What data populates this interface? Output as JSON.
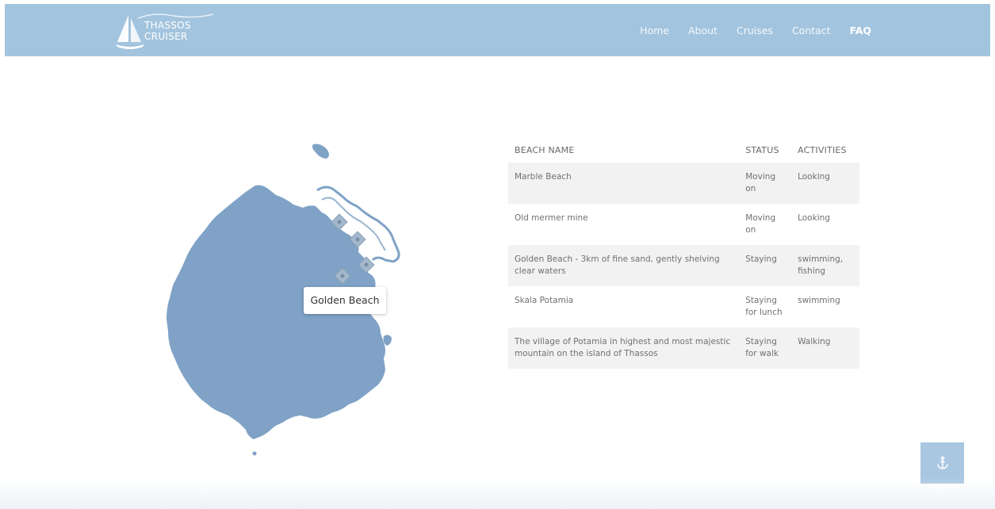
{
  "header": {
    "logo": {
      "line1": "THASSOS",
      "line2": "CRUISER"
    },
    "nav": [
      {
        "label": "Home",
        "active": false
      },
      {
        "label": "About",
        "active": false
      },
      {
        "label": "Cruises",
        "active": false
      },
      {
        "label": "Contact",
        "active": false
      },
      {
        "label": "FAQ",
        "active": true
      }
    ]
  },
  "map": {
    "tooltip": "Golden Beach",
    "marker_icon": "map-marker-icon",
    "island_color": "#7fa2c6"
  },
  "table": {
    "headers": {
      "name": "BEACH NAME",
      "status": "STATUS",
      "activities": "ACTIVITIES"
    },
    "rows": [
      {
        "name": "Marble Beach",
        "status": "Moving on",
        "activities": "Looking"
      },
      {
        "name": "Old mermer mine",
        "status": "Moving on",
        "activities": "Looking"
      },
      {
        "name": "Golden Beach - 3km of fine sand, gently shelving clear waters",
        "status": "Staying",
        "activities": "swimming, fishing"
      },
      {
        "name": "Skala Potamia",
        "status": "Staying for lunch",
        "activities": "swimming"
      },
      {
        "name": "The village of Potamia in highest and most majestic mountain on the island of Thassos",
        "status": "Staying for walk",
        "activities": "Walking"
      }
    ]
  },
  "anchor_button": {
    "icon": "anchor-icon"
  },
  "colors": {
    "navbar": "#a3c4de",
    "accent": "#a9c7e1",
    "row_alt": "#f2f2f2"
  }
}
